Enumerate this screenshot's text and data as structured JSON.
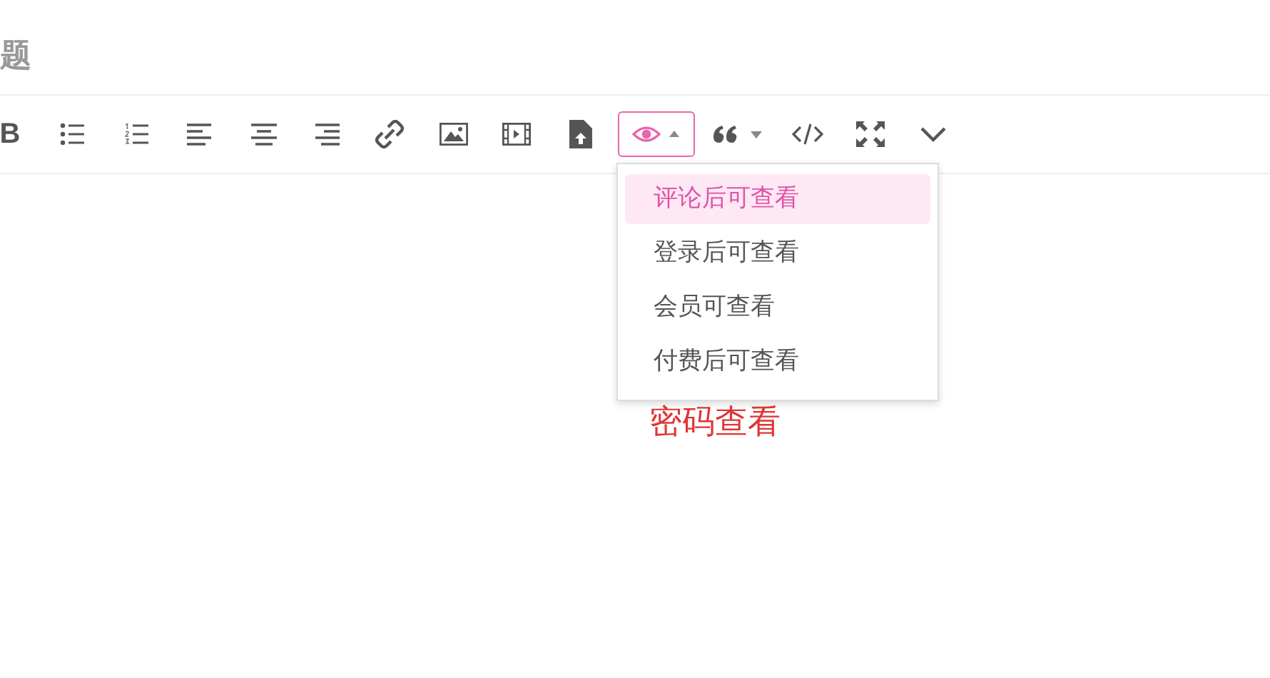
{
  "title": {
    "text": "题"
  },
  "toolbar": [
    {
      "kind": "bold",
      "label": "B"
    },
    {
      "kind": "ul"
    },
    {
      "kind": "ol"
    },
    {
      "kind": "align-left"
    },
    {
      "kind": "align-center"
    },
    {
      "kind": "align-right"
    },
    {
      "kind": "link"
    },
    {
      "kind": "image"
    },
    {
      "kind": "video"
    },
    {
      "kind": "file"
    },
    {
      "kind": "hide",
      "selected": true
    },
    {
      "kind": "quote"
    },
    {
      "kind": "code"
    },
    {
      "kind": "fullscreen"
    },
    {
      "kind": "more"
    }
  ],
  "menu": {
    "items": [
      {
        "label": "评论后可查看",
        "selected": true
      },
      {
        "label": "登录后可查看",
        "selected": false
      },
      {
        "label": "会员可查看",
        "selected": false
      },
      {
        "label": "付费后可查看",
        "selected": false
      }
    ]
  },
  "note": {
    "text": "密码查看"
  }
}
